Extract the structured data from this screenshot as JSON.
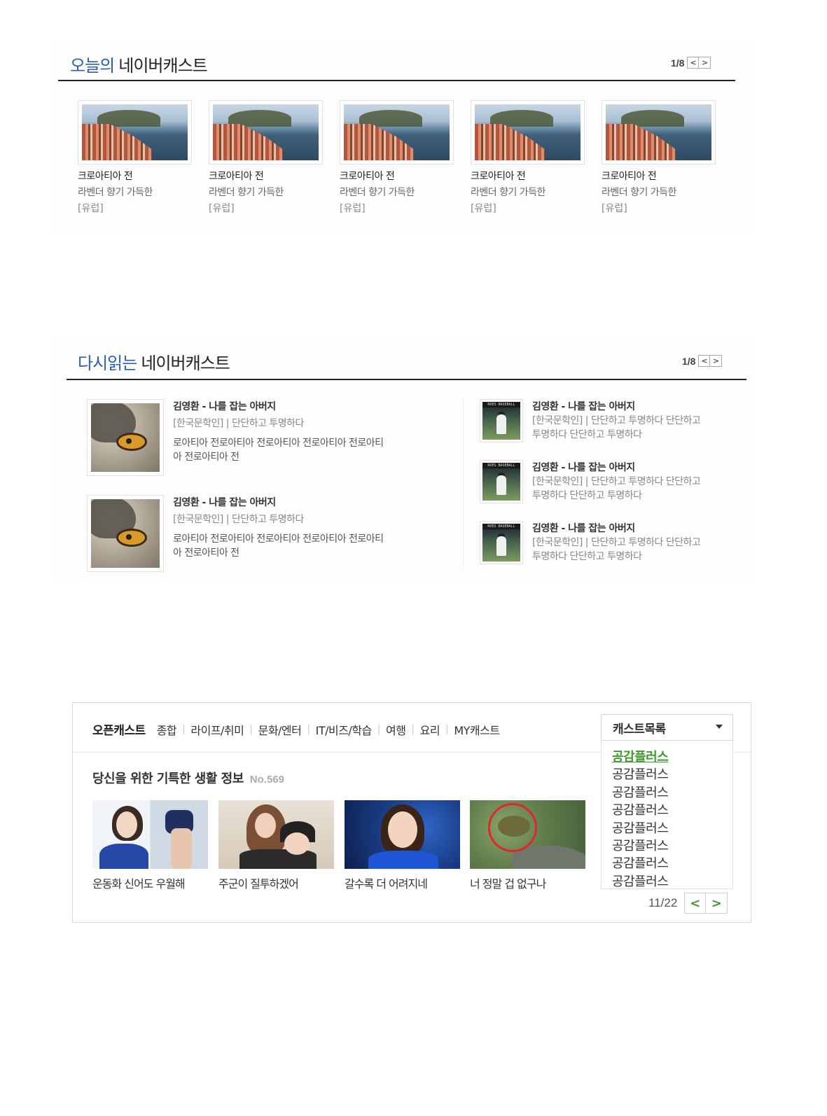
{
  "today": {
    "title_highlight": "오늘의",
    "title_rest": "네이버캐스트",
    "page": "1/8",
    "prev_label": "<",
    "next_label": ">",
    "cards": [
      {
        "title": "크로아티아 전",
        "subtitle": "라벤더 향기 가득한",
        "tag": "[유럽]"
      },
      {
        "title": "크로아티아 전",
        "subtitle": "라벤더 향기 가득한",
        "tag": "[유럽]"
      },
      {
        "title": "크로아티아 전",
        "subtitle": "라벤더 향기 가득한",
        "tag": "[유럽]"
      },
      {
        "title": "크로아티아 전",
        "subtitle": "라벤더 향기 가득한",
        "tag": "[유럽]"
      },
      {
        "title": "크로아티아 전",
        "subtitle": "라벤더 향기 가득한",
        "tag": "[유럽]"
      }
    ]
  },
  "reread": {
    "title_highlight": "다시읽는",
    "title_rest": "네이버캐스트",
    "page": "1/8",
    "prev_label": "<",
    "next_label": ">",
    "large_items": [
      {
        "title": "김영환 - 나를 잡는 아버지",
        "meta": "[한국문학인] | 단단하고 투명하다",
        "desc1": "로아티아 전로아티아 전로아티아 전로아티아 전로아티",
        "desc2": "아 전로아티아 전"
      },
      {
        "title": "김영환 - 나를 잡는 아버지",
        "meta": "[한국문학인] | 단단하고 투명하다",
        "desc1": "로아티아 전로아티아 전로아티아 전로아티아 전로아티",
        "desc2": "아 전로아티아 전"
      }
    ],
    "small_items": [
      {
        "title": "김영환 - 나를 잡는 아버지",
        "meta1": "[한국문학인] | 단단하고 투명하다 단단하고",
        "meta2": "투명하다 단단하고 투명하다",
        "thumb_text": "ROES BASEBALL"
      },
      {
        "title": "김영환 - 나를 잡는 아버지",
        "meta1": "[한국문학인] | 단단하고 투명하다 단단하고",
        "meta2": "투명하다 단단하고 투명하다",
        "thumb_text": "ROES BASEBALL"
      },
      {
        "title": "김영환 - 나를 잡는 아버지",
        "meta1": "[한국문학인] | 단단하고 투명하다 단단하고",
        "meta2": "투명하다 단단하고 투명하다",
        "thumb_text": "ROES BASEBALL"
      }
    ]
  },
  "opencast": {
    "brand": "오픈캐스트",
    "nav": [
      "종합",
      "라이프/취미",
      "문화/엔터",
      "IT/비즈/학습",
      "여행",
      "요리",
      "MY캐스트"
    ],
    "headline": "당신을 위한 기특한 생활 정보",
    "issue_no": "No.569",
    "cards": [
      {
        "caption": "운동화 신어도 우월해"
      },
      {
        "caption": "주군이 질투하겠어"
      },
      {
        "caption": "갈수록 더 어려지네"
      },
      {
        "caption": "너 정말 겁 없구나"
      }
    ],
    "dropdown_label": "캐스트목록",
    "list_items": [
      "공감플러스",
      "공감플러스",
      "공감플러스",
      "공감플러스",
      "공감플러스",
      "공감플러스",
      "공감플러스",
      "공감플러스"
    ],
    "page": "11/22",
    "prev_label": "<",
    "next_label": ">",
    "accent_color": "#3e9a2b"
  }
}
